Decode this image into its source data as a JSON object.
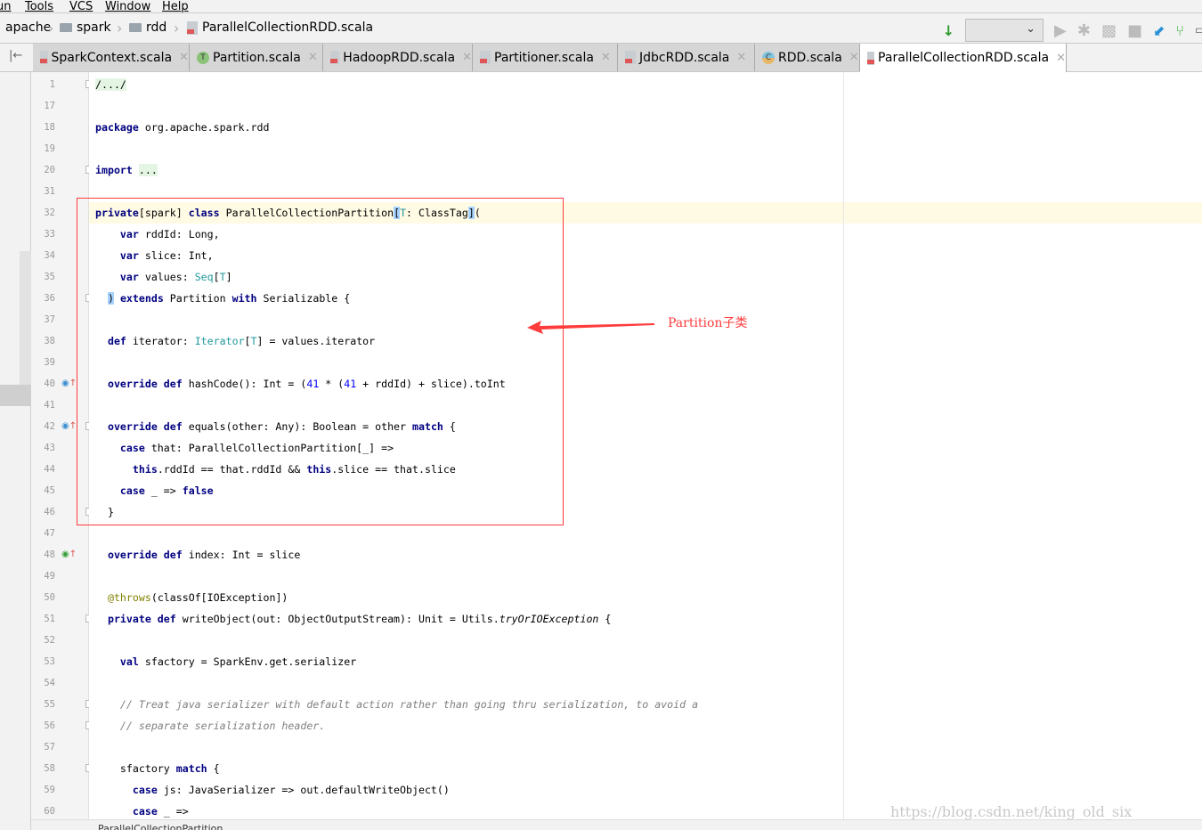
{
  "menu": [
    "un",
    "Tools",
    "VCS",
    "Window",
    "Help"
  ],
  "breadcrumb": [
    "apache",
    "spark",
    "rdd",
    "ParallelCollectionRDD.scala"
  ],
  "toolbar": {
    "config_select": "",
    "icons": [
      "build-icon",
      "run-icon",
      "debug-icon",
      "coverage-icon",
      "stop-icon",
      "vcs-update-icon",
      "vcs-commit-icon",
      "screen-icon"
    ]
  },
  "tabs": [
    {
      "label": "SparkContext.scala",
      "icon": "scala-file",
      "active": false
    },
    {
      "label": "Partition.scala",
      "icon": "trait",
      "active": false
    },
    {
      "label": "HadoopRDD.scala",
      "icon": "scala-file",
      "active": false
    },
    {
      "label": "Partitioner.scala",
      "icon": "scala-file",
      "active": false
    },
    {
      "label": "JdbcRDD.scala",
      "icon": "scala-file",
      "active": false
    },
    {
      "label": "RDD.scala",
      "icon": "class",
      "active": false
    },
    {
      "label": "ParallelCollectionRDD.scala",
      "icon": "scala-file",
      "active": true
    }
  ],
  "colors": {
    "keyword": "#000080",
    "type": "#20999d",
    "number": "#0000ff",
    "comment": "#808080",
    "annotation": "#808000",
    "annotation_red": "#ff3b3b",
    "current_line": "#fffae3"
  },
  "code": [
    {
      "num": "1",
      "fold": true,
      "tokens": [
        [
          "fb",
          "/.../"
        ]
      ]
    },
    {
      "num": "17",
      "tokens": []
    },
    {
      "num": "18",
      "tokens": [
        [
          "k",
          "package"
        ],
        [
          "",
          " org.apache.spark.rdd"
        ]
      ]
    },
    {
      "num": "19",
      "tokens": []
    },
    {
      "num": "20",
      "fold": true,
      "tokens": [
        [
          "k",
          "import"
        ],
        [
          "",
          " "
        ],
        [
          "fb",
          "..."
        ]
      ]
    },
    {
      "num": "31",
      "tokens": []
    },
    {
      "num": "32",
      "current": true,
      "tokens": [
        [
          "k",
          "private"
        ],
        [
          "",
          "[spark] "
        ],
        [
          "k",
          "class"
        ],
        [
          "",
          " ParallelCollectionPartition"
        ],
        [
          "hl",
          "["
        ],
        [
          "t",
          "T"
        ],
        [
          "",
          ": ClassTag"
        ],
        [
          "hl",
          "]"
        ],
        [
          "",
          "("
        ]
      ]
    },
    {
      "num": "33",
      "tokens": [
        [
          "",
          "    "
        ],
        [
          "k",
          "var"
        ],
        [
          "",
          " rddId: Long,"
        ]
      ]
    },
    {
      "num": "34",
      "tokens": [
        [
          "",
          "    "
        ],
        [
          "k",
          "var"
        ],
        [
          "",
          " slice: Int,"
        ]
      ]
    },
    {
      "num": "35",
      "tokens": [
        [
          "",
          "    "
        ],
        [
          "k",
          "var"
        ],
        [
          "",
          " values: "
        ],
        [
          "t",
          "Seq"
        ],
        [
          "",
          "["
        ],
        [
          "t",
          "T"
        ],
        [
          "",
          "]"
        ]
      ]
    },
    {
      "num": "36",
      "fold": true,
      "tokens": [
        [
          "",
          "  "
        ],
        [
          "hl",
          ")"
        ],
        [
          "",
          " "
        ],
        [
          "k",
          "extends"
        ],
        [
          "",
          " Partition "
        ],
        [
          "k",
          "with"
        ],
        [
          "",
          " Serializable {"
        ]
      ]
    },
    {
      "num": "37",
      "tokens": []
    },
    {
      "num": "38",
      "tokens": [
        [
          "",
          "  "
        ],
        [
          "k",
          "def"
        ],
        [
          "",
          " iterator: "
        ],
        [
          "t",
          "Iterator"
        ],
        [
          "",
          "["
        ],
        [
          "t",
          "T"
        ],
        [
          "",
          "] = values.iterator"
        ]
      ]
    },
    {
      "num": "39",
      "tokens": []
    },
    {
      "num": "40",
      "gutter": "override",
      "tokens": [
        [
          "",
          "  "
        ],
        [
          "k",
          "override def"
        ],
        [
          "",
          " hashCode(): Int = ("
        ],
        [
          "n",
          "41"
        ],
        [
          "",
          " * ("
        ],
        [
          "n",
          "41"
        ],
        [
          "",
          " + rddId) + slice).toInt"
        ]
      ]
    },
    {
      "num": "41",
      "tokens": []
    },
    {
      "num": "42",
      "gutter": "override",
      "fold": true,
      "tokens": [
        [
          "",
          "  "
        ],
        [
          "k",
          "override def"
        ],
        [
          "",
          " equals(other: Any): Boolean = other "
        ],
        [
          "k",
          "match"
        ],
        [
          "",
          " {"
        ]
      ]
    },
    {
      "num": "43",
      "tokens": [
        [
          "",
          "    "
        ],
        [
          "k",
          "case"
        ],
        [
          "",
          " that: ParallelCollectionPartition[_] =>"
        ]
      ]
    },
    {
      "num": "44",
      "tokens": [
        [
          "",
          "      "
        ],
        [
          "k",
          "this"
        ],
        [
          "",
          ".rddId == that.rddId && "
        ],
        [
          "k",
          "this"
        ],
        [
          "",
          ".slice == that.slice"
        ]
      ]
    },
    {
      "num": "45",
      "tokens": [
        [
          "",
          "    "
        ],
        [
          "k",
          "case"
        ],
        [
          "",
          " _ => "
        ],
        [
          "k",
          "false"
        ]
      ]
    },
    {
      "num": "46",
      "fold": true,
      "tokens": [
        [
          "",
          "  }"
        ]
      ]
    },
    {
      "num": "47",
      "tokens": []
    },
    {
      "num": "48",
      "gutter": "implements",
      "tokens": [
        [
          "",
          "  "
        ],
        [
          "k",
          "override def"
        ],
        [
          "",
          " index: Int = slice"
        ]
      ]
    },
    {
      "num": "49",
      "tokens": []
    },
    {
      "num": "50",
      "tokens": [
        [
          "",
          "  "
        ],
        [
          "a",
          "@throws"
        ],
        [
          "",
          "(classOf[IOException])"
        ]
      ]
    },
    {
      "num": "51",
      "fold": true,
      "tokens": [
        [
          "",
          "  "
        ],
        [
          "k",
          "private def"
        ],
        [
          "",
          " writeObject(out: ObjectOutputStream): Unit = Utils."
        ],
        [
          "i",
          "tryOrIOException"
        ],
        [
          "",
          " {"
        ]
      ]
    },
    {
      "num": "52",
      "tokens": []
    },
    {
      "num": "53",
      "tokens": [
        [
          "",
          "    "
        ],
        [
          "k",
          "val"
        ],
        [
          "",
          " sfactory = SparkEnv.get.serializer"
        ]
      ]
    },
    {
      "num": "54",
      "tokens": []
    },
    {
      "num": "55",
      "fold": true,
      "tokens": [
        [
          "",
          "    "
        ],
        [
          "c",
          "// Treat java serializer with default action rather than going thru serialization, to avoid a"
        ]
      ]
    },
    {
      "num": "56",
      "fold": true,
      "tokens": [
        [
          "",
          "    "
        ],
        [
          "c",
          "// separate serialization header."
        ]
      ]
    },
    {
      "num": "57",
      "tokens": []
    },
    {
      "num": "58",
      "fold": true,
      "tokens": [
        [
          "",
          "    sfactory "
        ],
        [
          "k",
          "match"
        ],
        [
          "",
          " {"
        ]
      ]
    },
    {
      "num": "59",
      "tokens": [
        [
          "",
          "      "
        ],
        [
          "k",
          "case"
        ],
        [
          "",
          " js: JavaSerializer => out.defaultWriteObject()"
        ]
      ]
    },
    {
      "num": "60",
      "tokens": [
        [
          "",
          "      "
        ],
        [
          "k",
          "case"
        ],
        [
          "",
          " _ =>"
        ]
      ]
    }
  ],
  "annotation": {
    "label": "Partition子类"
  },
  "status_breadcrumb": "ParallelCollectionPartition",
  "watermark": "https://blog.csdn.net/king_old_six"
}
